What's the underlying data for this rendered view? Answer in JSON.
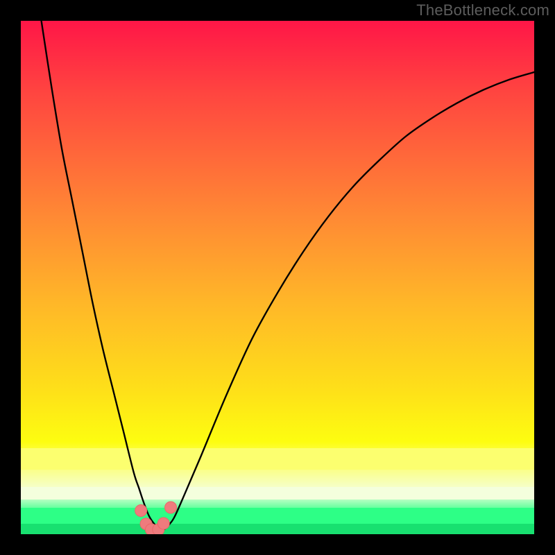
{
  "watermark": "TheBottleneck.com",
  "colors": {
    "frame": "#000000",
    "grad_top": "#ff1647",
    "grad_1": "#ff4540",
    "grad_2": "#ff8934",
    "grad_3": "#ffb728",
    "grad_4": "#fee019",
    "grad_5": "#fdfd10",
    "grad_yellow_band": "#fcff6f",
    "grad_pale": "#f4ffdd",
    "grad_green_main": "#2dff86",
    "grad_green_dark": "#18e070",
    "curve": "#000000",
    "marker_fill": "#ee7b7d",
    "marker_stroke": "#eb6668"
  },
  "chart_data": {
    "type": "line",
    "title": "",
    "xlabel": "",
    "ylabel": "",
    "xlim": [
      0,
      100
    ],
    "ylim": [
      0,
      100
    ],
    "note": "Axes are unlabeled in the source image; x/y units are percent of plot area. Curve values estimated from pixel positions (y = 0 at bottom, 100 at top).",
    "series": [
      {
        "name": "bottleneck-curve",
        "x": [
          4,
          6,
          8,
          10,
          12,
          14,
          16,
          18,
          20,
          22,
          23,
          24,
          25,
          26,
          27,
          28,
          29,
          30,
          32,
          35,
          40,
          45,
          50,
          55,
          60,
          65,
          70,
          75,
          80,
          85,
          90,
          95,
          100
        ],
        "y": [
          100,
          87,
          75,
          65,
          55,
          45,
          36,
          28,
          20,
          12,
          9,
          6,
          3.5,
          2,
          1,
          1,
          2,
          3.5,
          8,
          15,
          27,
          38,
          47,
          55,
          62,
          68,
          73,
          77.5,
          81,
          84,
          86.5,
          88.5,
          90
        ]
      }
    ],
    "markers": {
      "name": "highlight-dots",
      "x": [
        23.4,
        24.4,
        25.4,
        26.8,
        27.8,
        29.2
      ],
      "y": [
        4.6,
        2.0,
        0.9,
        0.9,
        2.1,
        5.2
      ]
    }
  }
}
